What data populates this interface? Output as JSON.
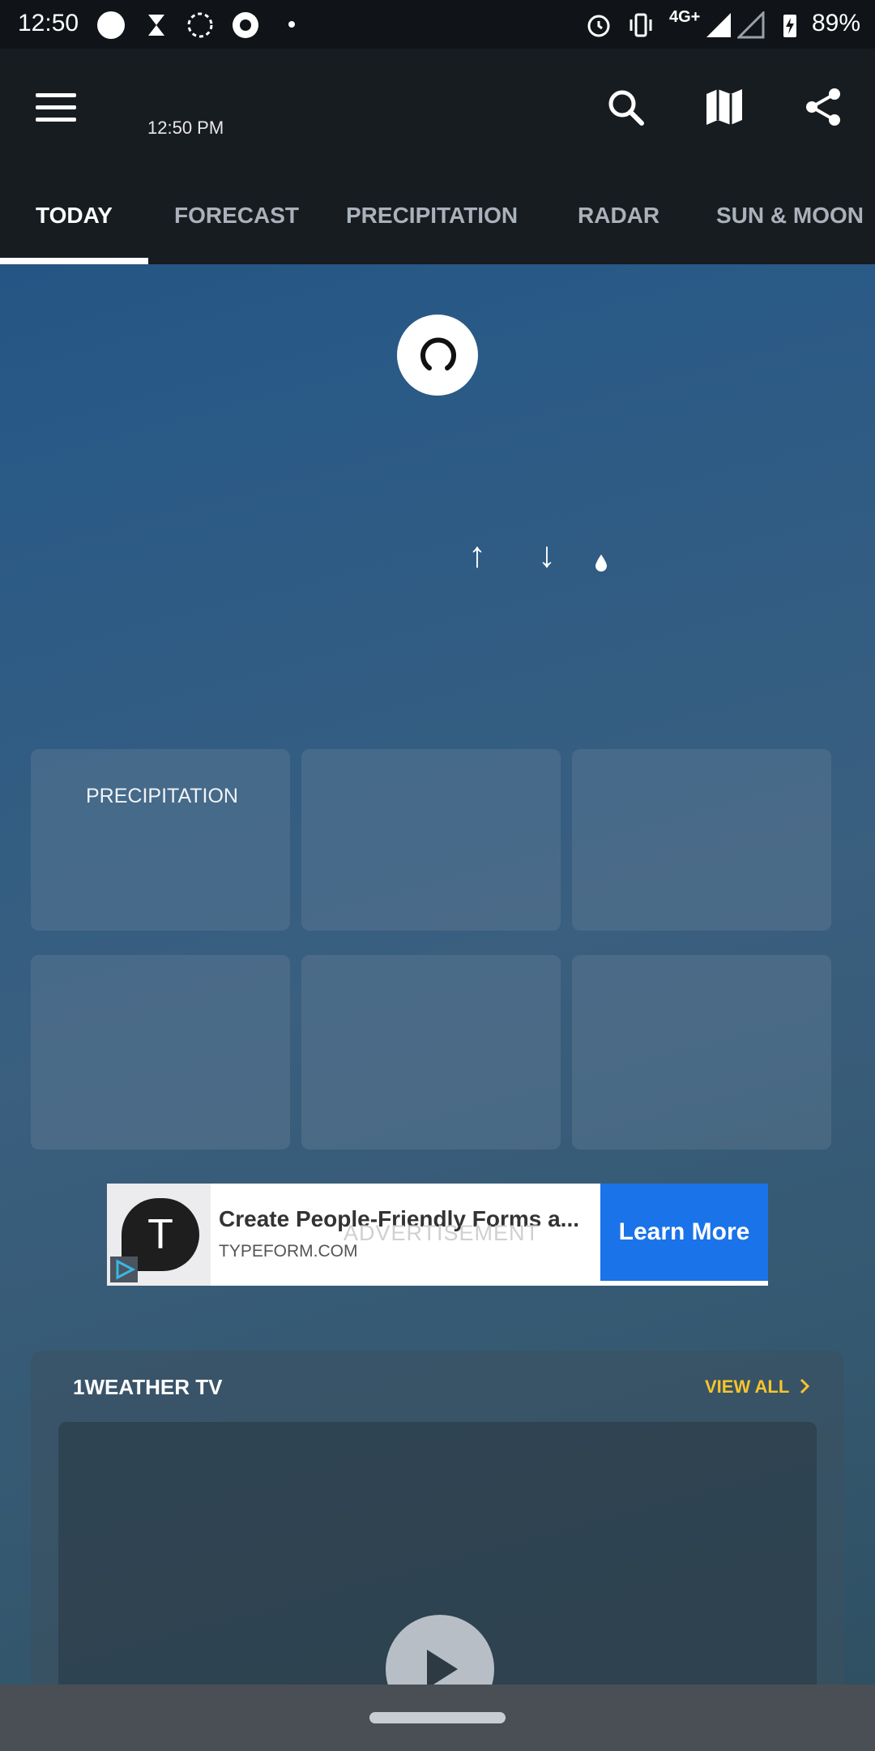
{
  "status_bar": {
    "time": "12:50",
    "network": "4G+",
    "battery": "89%"
  },
  "header": {
    "time": "12:50 PM"
  },
  "tabs": [
    {
      "label": "TODAY",
      "active": true
    },
    {
      "label": "FORECAST",
      "active": false
    },
    {
      "label": "PRECIPITATION",
      "active": false
    },
    {
      "label": "RADAR",
      "active": false
    },
    {
      "label": "SUN & MOON",
      "active": false
    }
  ],
  "today": {
    "high_arrow": "↑",
    "low_arrow": "↓"
  },
  "cards": [
    {
      "label": "PRECIPITATION"
    },
    {
      "label": ""
    },
    {
      "label": ""
    },
    {
      "label": ""
    },
    {
      "label": ""
    },
    {
      "label": ""
    }
  ],
  "ad": {
    "logo_letter": "T",
    "title": "Create People-Friendly Forms a...",
    "domain": "TYPEFORM.COM",
    "watermark": "ADVERTISEMENT",
    "cta": "Learn More"
  },
  "tv": {
    "title": "1WEATHER TV",
    "view_all": "VIEW ALL"
  },
  "colors": {
    "accent_tab": "#ffffff",
    "view_all": "#f7c52b",
    "cta": "#1a73e8"
  }
}
